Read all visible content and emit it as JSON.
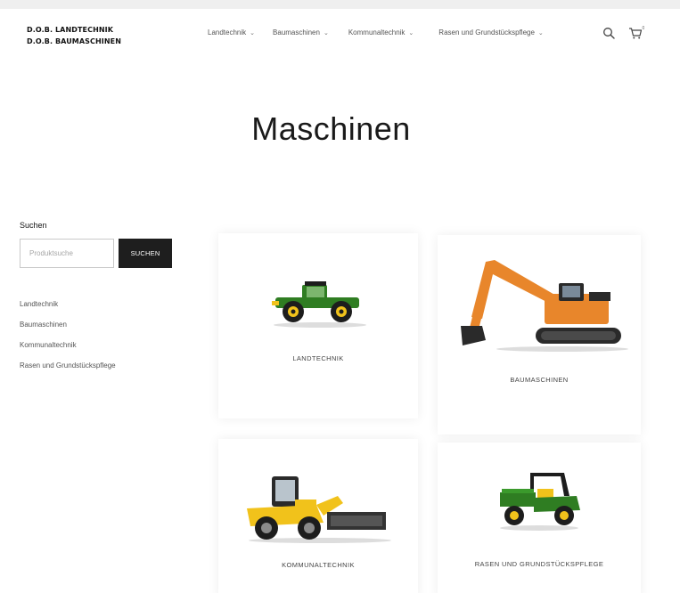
{
  "brand": {
    "line1": "D.O.B. LANDTECHNIK",
    "line2": "D.O.B. BAUMASCHINEN"
  },
  "nav": {
    "items": [
      {
        "label": "Landtechnik"
      },
      {
        "label": "Baumaschinen"
      },
      {
        "label": "Kommunaltechnik"
      },
      {
        "label": "Rasen und Grundstückspflege"
      }
    ],
    "cart_count": "0",
    "icons": [
      "search-icon",
      "cart-icon",
      "chevron-down-icon"
    ]
  },
  "page": {
    "title": "Maschinen"
  },
  "sidebar": {
    "search_label": "Suchen",
    "search_placeholder": "Produktsuche",
    "search_button": "SUCHEN",
    "categories": [
      {
        "label": "Landtechnik"
      },
      {
        "label": "Baumaschinen"
      },
      {
        "label": "Kommunaltechnik"
      },
      {
        "label": "Rasen und Grundstückspflege"
      }
    ]
  },
  "products": [
    {
      "label": "LANDTECHNIK",
      "image": "green-tractor"
    },
    {
      "label": "BAUMASCHINEN",
      "image": "orange-excavator"
    },
    {
      "label": "KOMMUNALTECHNIK",
      "image": "yellow-wheel-loader"
    },
    {
      "label": "RASEN UND GRUNDSTÜCKSPFLEGE",
      "image": "green-utility-vehicle"
    }
  ],
  "colors": {
    "brand_green": "#2f7d22",
    "excavator_orange": "#e8862b",
    "loader_yellow": "#f1c21b",
    "button_dark": "#1e1e1e"
  }
}
